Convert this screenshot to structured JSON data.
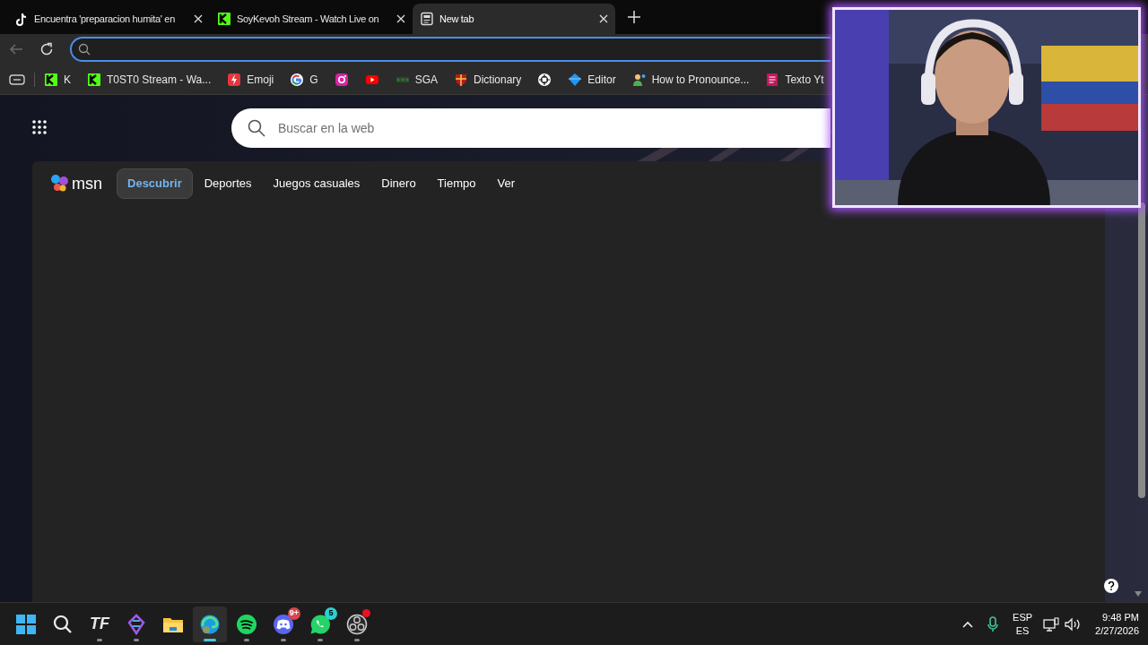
{
  "tabs": [
    {
      "title": "Encuentra 'preparacion humita' en",
      "kind": "tiktok",
      "selected": false
    },
    {
      "title": "SoyKevoh Stream - Watch Live on",
      "kind": "kick",
      "selected": false
    },
    {
      "title": "New tab",
      "kind": "newtab",
      "selected": true
    }
  ],
  "bookmarks": [
    {
      "kind": "kick",
      "label": "K"
    },
    {
      "kind": "kick",
      "label": "T0ST0 Stream - Wa..."
    },
    {
      "kind": "bolt",
      "label": "Emoji"
    },
    {
      "kind": "google",
      "label": "G"
    },
    {
      "kind": "instagram"
    },
    {
      "kind": "youtube"
    },
    {
      "kind": "sga",
      "label": "SGA"
    },
    {
      "kind": "crest",
      "label": "Dictionary"
    },
    {
      "kind": "knot"
    },
    {
      "kind": "diamond",
      "label": "Editor"
    },
    {
      "kind": "person",
      "label": "How to Pronounce..."
    },
    {
      "kind": "doc",
      "label": "Texto Yt"
    }
  ],
  "search": {
    "placeholder": "Buscar en la web"
  },
  "msn": {
    "logo": "msn",
    "nav": [
      {
        "label": "Descubrir",
        "selected": true
      },
      {
        "label": "Deportes",
        "selected": false
      },
      {
        "label": "Juegos casuales",
        "selected": false
      },
      {
        "label": "Dinero",
        "selected": false
      },
      {
        "label": "Tiempo",
        "selected": false
      },
      {
        "label": "Ver",
        "selected": false
      }
    ]
  },
  "taskbar": {
    "apps": [
      {
        "kind": "windows",
        "running": false,
        "selected": false
      },
      {
        "kind": "search",
        "running": false,
        "selected": false
      },
      {
        "kind": "tf",
        "label": "TF",
        "running": true,
        "selected": false
      },
      {
        "kind": "gem",
        "running": true,
        "selected": false
      },
      {
        "kind": "folder",
        "running": false,
        "selected": false
      },
      {
        "kind": "edge",
        "running": true,
        "selected": true
      },
      {
        "kind": "spotify",
        "running": true,
        "selected": false
      },
      {
        "kind": "discord",
        "badge": "9+",
        "running": true,
        "selected": false
      },
      {
        "kind": "whatsapp",
        "badge": "5",
        "running": true,
        "selected": false
      },
      {
        "kind": "obs",
        "alert": true,
        "running": true,
        "selected": false
      }
    ],
    "language": "ESP",
    "layout": "ES",
    "time": "9:48 PM",
    "date": "2/27/2026"
  }
}
